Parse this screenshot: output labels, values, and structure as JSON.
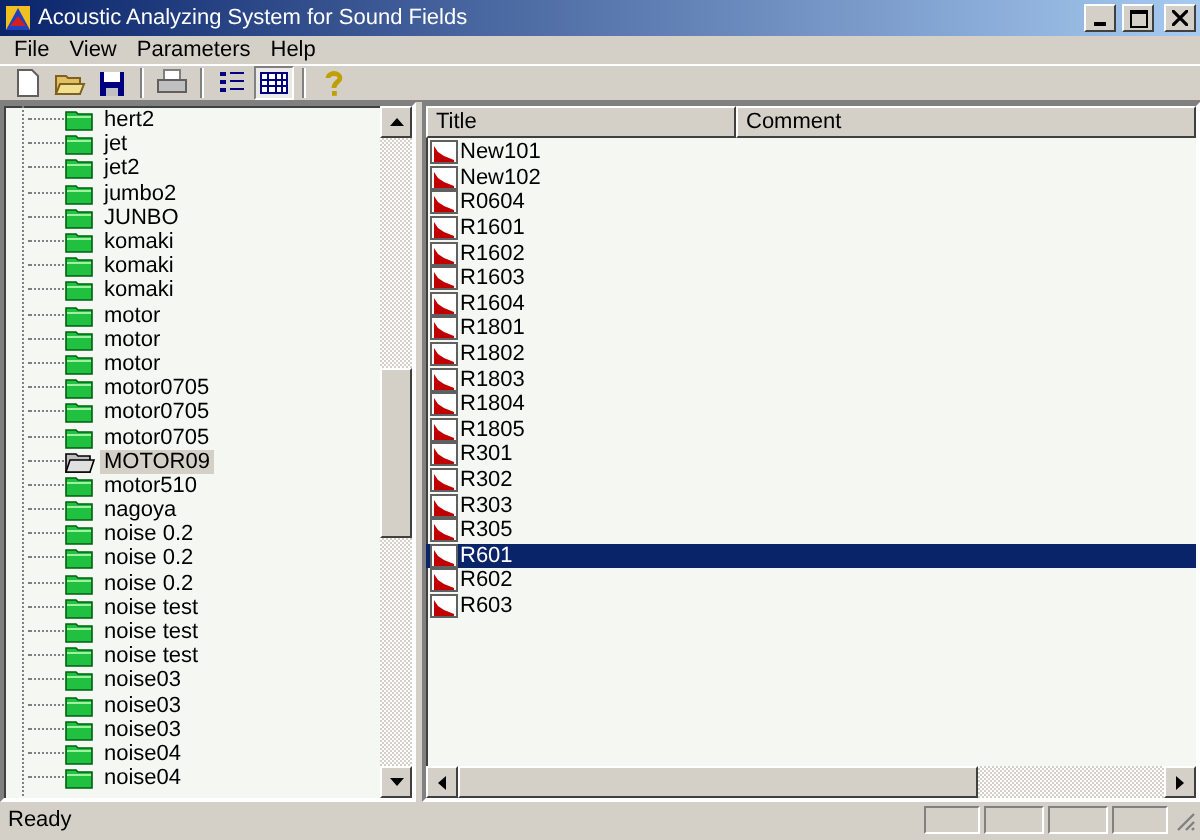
{
  "window": {
    "title": "Acoustic Analyzing System for Sound Fields"
  },
  "menu": [
    {
      "label": "File"
    },
    {
      "label": "View"
    },
    {
      "label": "Parameters"
    },
    {
      "label": "Help"
    }
  ],
  "tree": {
    "items": [
      {
        "label": "hert2",
        "selected": false
      },
      {
        "label": "jet",
        "selected": false
      },
      {
        "label": "jet2",
        "selected": false
      },
      {
        "label": "jumbo2",
        "selected": false
      },
      {
        "label": "JUNBO",
        "selected": false
      },
      {
        "label": "komaki",
        "selected": false
      },
      {
        "label": "komaki",
        "selected": false
      },
      {
        "label": "komaki",
        "selected": false
      },
      {
        "label": "motor",
        "selected": false
      },
      {
        "label": "motor",
        "selected": false
      },
      {
        "label": "motor",
        "selected": false
      },
      {
        "label": "motor0705",
        "selected": false
      },
      {
        "label": "motor0705",
        "selected": false
      },
      {
        "label": "motor0705",
        "selected": false
      },
      {
        "label": "MOTOR09",
        "selected": true
      },
      {
        "label": "motor510",
        "selected": false
      },
      {
        "label": "nagoya",
        "selected": false
      },
      {
        "label": "noise 0.2",
        "selected": false
      },
      {
        "label": "noise 0.2",
        "selected": false
      },
      {
        "label": "noise 0.2",
        "selected": false
      },
      {
        "label": "noise test",
        "selected": false
      },
      {
        "label": "noise test",
        "selected": false
      },
      {
        "label": "noise test",
        "selected": false
      },
      {
        "label": "noise03",
        "selected": false
      },
      {
        "label": "noise03",
        "selected": false
      },
      {
        "label": "noise03",
        "selected": false
      },
      {
        "label": "noise04",
        "selected": false
      },
      {
        "label": "noise04",
        "selected": false
      }
    ]
  },
  "list": {
    "columns": [
      "Title",
      "Comment"
    ],
    "rows": [
      {
        "title": "New101",
        "selected": false
      },
      {
        "title": "New102",
        "selected": false
      },
      {
        "title": "R0604",
        "selected": false
      },
      {
        "title": "R1601",
        "selected": false
      },
      {
        "title": "R1602",
        "selected": false
      },
      {
        "title": "R1603",
        "selected": false
      },
      {
        "title": "R1604",
        "selected": false
      },
      {
        "title": "R1801",
        "selected": false
      },
      {
        "title": "R1802",
        "selected": false
      },
      {
        "title": "R1803",
        "selected": false
      },
      {
        "title": "R1804",
        "selected": false
      },
      {
        "title": "R1805",
        "selected": false
      },
      {
        "title": "R301",
        "selected": false
      },
      {
        "title": "R302",
        "selected": false
      },
      {
        "title": "R303",
        "selected": false
      },
      {
        "title": "R305",
        "selected": false
      },
      {
        "title": "R601",
        "selected": true
      },
      {
        "title": "R602",
        "selected": false
      },
      {
        "title": "R603",
        "selected": false
      }
    ]
  },
  "status_bar": {
    "text": "Ready"
  }
}
